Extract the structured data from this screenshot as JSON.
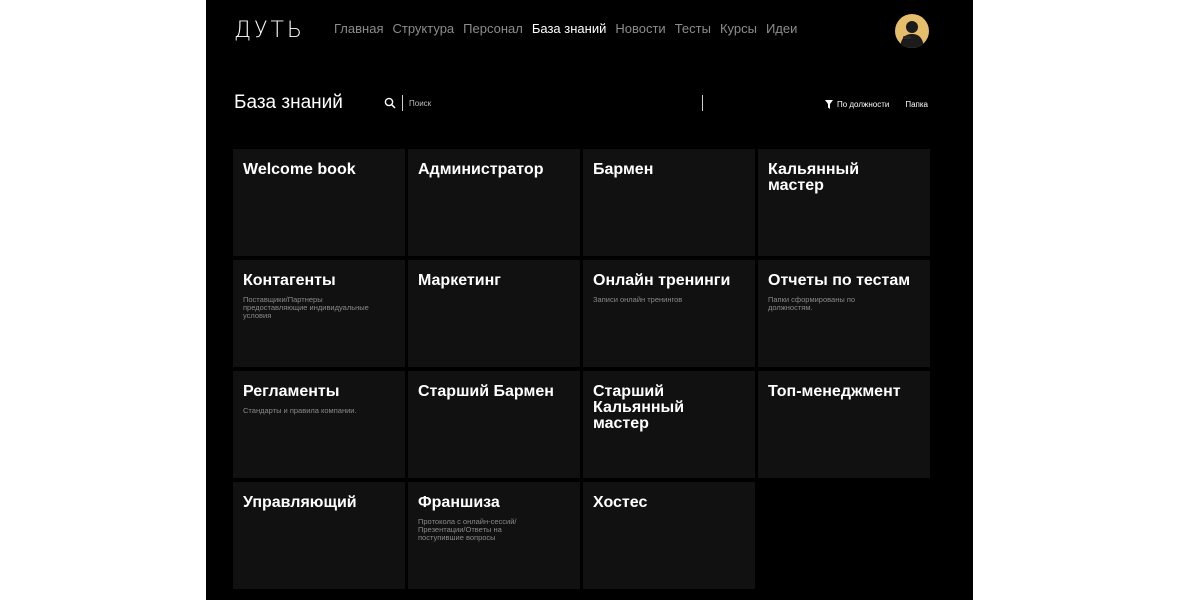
{
  "app": {
    "logo": "ДУТЬ"
  },
  "nav": {
    "items": [
      {
        "label": "Главная"
      },
      {
        "label": "Структура"
      },
      {
        "label": "Персонал"
      },
      {
        "label": "База знаний",
        "active": true
      },
      {
        "label": "Новости"
      },
      {
        "label": "Тесты"
      },
      {
        "label": "Курсы"
      },
      {
        "label": "Идеи"
      }
    ]
  },
  "page": {
    "title": "База знаний"
  },
  "search": {
    "placeholder": "Поиск",
    "value": ""
  },
  "filters": {
    "by_position": "По должности",
    "folder": "Папка"
  },
  "cards": [
    {
      "title": "Welcome book",
      "description": ""
    },
    {
      "title": "Администратор",
      "description": ""
    },
    {
      "title": "Бармен",
      "description": ""
    },
    {
      "title": "Кальянный мастер",
      "description": ""
    },
    {
      "title": "Контагенты",
      "description": "Поставщики/Партнеры предоставляющие индивидуальные условия"
    },
    {
      "title": "Маркетинг",
      "description": ""
    },
    {
      "title": "Онлайн тренинги",
      "description": "Записи онлайн тренингов"
    },
    {
      "title": "Отчеты по тестам",
      "description": "Папки сформированы по должностям."
    },
    {
      "title": "Регламенты",
      "description": "Стандарты и правила компании."
    },
    {
      "title": "Старший Бармен",
      "description": ""
    },
    {
      "title": "Старший Кальянный мастер",
      "description": ""
    },
    {
      "title": "Топ-менеджмент",
      "description": ""
    },
    {
      "title": "Управляющий",
      "description": ""
    },
    {
      "title": "Франшиза",
      "description": "Протокола с онлайн-сессий/ Презентации/Ответы на поступившие вопросы"
    },
    {
      "title": "Хостес",
      "description": ""
    }
  ],
  "colors": {
    "background": "#000000",
    "card": "#111111",
    "text": "#ffffff",
    "muted": "#8c8c8c",
    "avatar": "#e6bd6a"
  }
}
